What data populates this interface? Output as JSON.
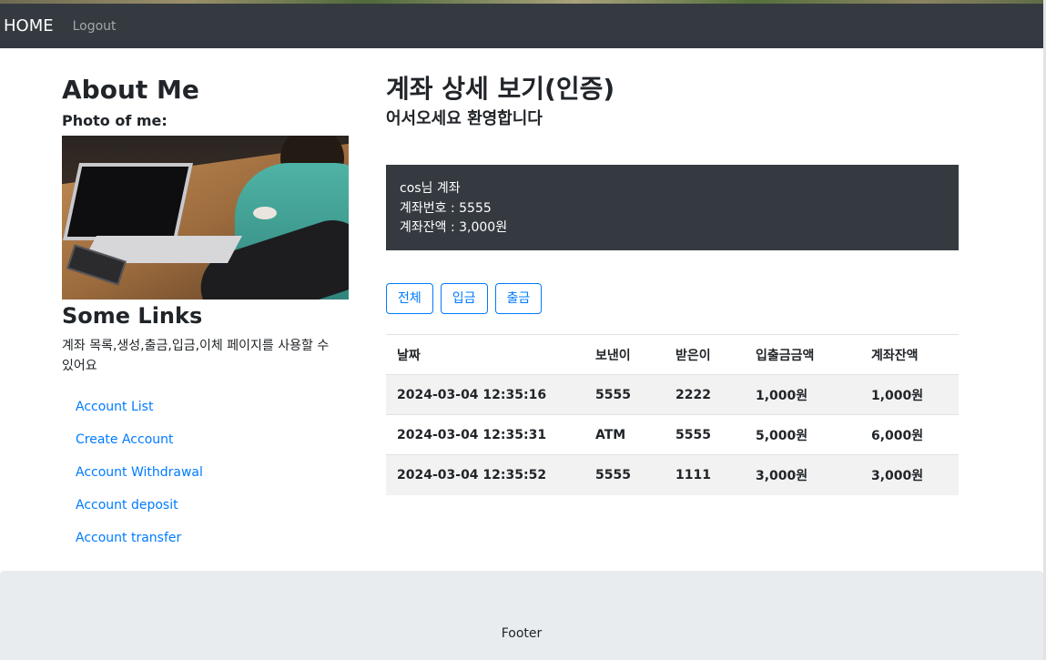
{
  "navbar": {
    "brand": "HOME",
    "logout": "Logout"
  },
  "sidebar": {
    "title": "About Me",
    "photo_label": "Photo of me:",
    "links_title": "Some Links",
    "links_description": "계좌 목록,생성,출금,입금,이체 페이지를 사용할 수 있어요",
    "links": [
      {
        "label": "Account List"
      },
      {
        "label": "Create Account"
      },
      {
        "label": "Account Withdrawal"
      },
      {
        "label": "Account deposit"
      },
      {
        "label": "Account transfer"
      }
    ]
  },
  "main": {
    "title": "계좌 상세 보기(인증)",
    "subtitle": "어서오세요 환영합니다",
    "account": {
      "owner_line": "cos님 계좌",
      "number_line": "계좌번호 : 5555",
      "balance_line": "계좌잔액 : 3,000원"
    },
    "filters": [
      "전체",
      "입금",
      "출금"
    ],
    "table": {
      "headers": [
        "날짜",
        "보낸이",
        "받은이",
        "입출금금액",
        "계좌잔액"
      ],
      "rows": [
        [
          "2024-03-04 12:35:16",
          "5555",
          "2222",
          "1,000원",
          "1,000원"
        ],
        [
          "2024-03-04 12:35:31",
          "ATM",
          "5555",
          "5,000원",
          "6,000원"
        ],
        [
          "2024-03-04 12:35:52",
          "5555",
          "1111",
          "3,000원",
          "3,000원"
        ]
      ]
    }
  },
  "footer": {
    "text": "Footer"
  },
  "colors": {
    "navbar": "#343a40",
    "link": "#007bff",
    "footer": "#e9ecef",
    "stripe": "#f2f2f2"
  }
}
